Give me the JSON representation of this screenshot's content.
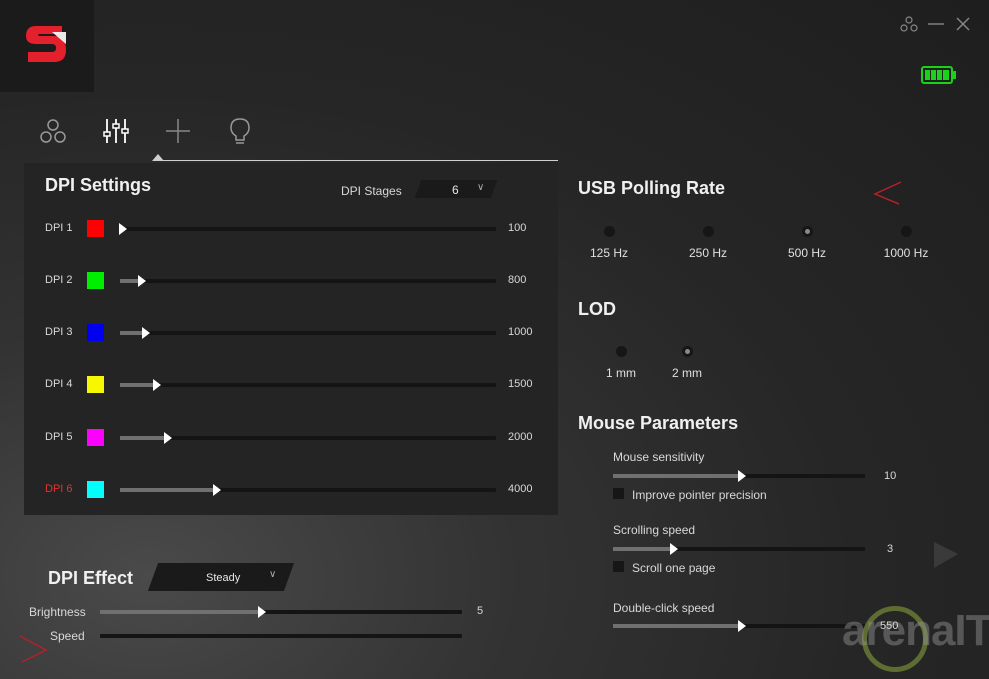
{
  "window": {
    "controls": [
      "account-icon",
      "minimize-icon",
      "close-icon"
    ]
  },
  "colors": {
    "accent": "#e3202b",
    "battery": "#19d219"
  },
  "tabs": [
    "profile-icon",
    "settings-sliders-icon",
    "plus-icon",
    "lightbulb-icon"
  ],
  "dpi": {
    "title": "DPI Settings",
    "stages_label": "DPI Stages",
    "stages_value": "6",
    "rows": [
      {
        "label": "DPI 1",
        "color": "#ff0000",
        "value": "100",
        "level": 0.0
      },
      {
        "label": "DPI 2",
        "color": "#00ee00",
        "value": "800",
        "level": 0.05
      },
      {
        "label": "DPI 3",
        "color": "#0000ee",
        "value": "1000",
        "level": 0.06
      },
      {
        "label": "DPI 4",
        "color": "#f7f700",
        "value": "1500",
        "level": 0.09
      },
      {
        "label": "DPI 5",
        "color": "#ff00ff",
        "value": "2000",
        "level": 0.12
      },
      {
        "label": "DPI 6",
        "color": "#00ffff",
        "value": "4000",
        "level": 0.25
      }
    ]
  },
  "effect": {
    "title": "DPI Effect",
    "mode": "Steady",
    "brightness_label": "Brightness",
    "brightness_value": "5",
    "brightness_level": 0.44,
    "speed_label": "Speed",
    "speed_level": 0.0
  },
  "polling": {
    "title": "USB Polling Rate",
    "options": [
      "125 Hz",
      "250 Hz",
      "500 Hz",
      "1000 Hz"
    ],
    "selected": 2
  },
  "lod": {
    "title": "LOD",
    "options": [
      "1 mm",
      "2 mm"
    ],
    "selected": 1
  },
  "mouse": {
    "title": "Mouse Parameters",
    "sensitivity_label": "Mouse sensitivity",
    "sensitivity_value": "10",
    "sensitivity_level": 0.5,
    "precision_label": "Improve pointer precision",
    "scroll_label": "Scrolling speed",
    "scroll_value": "3",
    "scroll_level": 0.23,
    "scroll_page_label": "Scroll one page",
    "dblclick_label": "Double-click speed",
    "dblclick_value": "550",
    "dblclick_level": 0.5
  },
  "watermark": "arenaIT"
}
